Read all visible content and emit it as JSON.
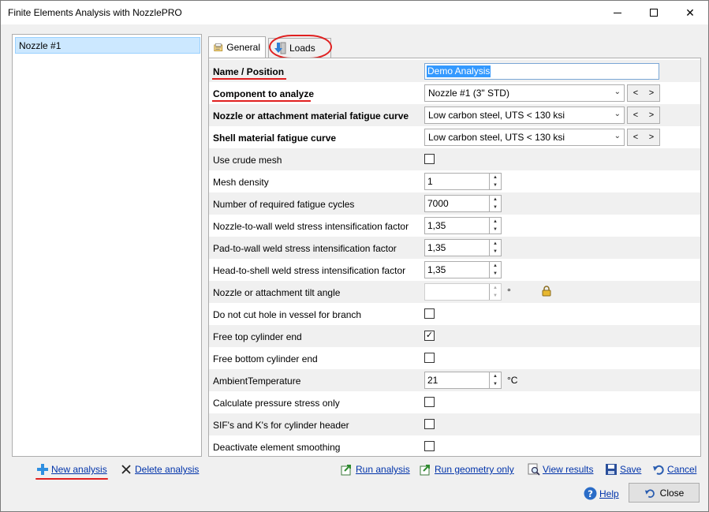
{
  "window": {
    "title": "Finite Elements Analysis with NozzlePRO"
  },
  "analyses": [
    {
      "label": "Nozzle #1"
    }
  ],
  "tabs": {
    "general": "General",
    "loads": "Loads"
  },
  "fields": {
    "name_position": {
      "label": "Name / Position",
      "value": "Demo Analysis"
    },
    "component": {
      "label": "Component to analyze",
      "value": "Nozzle #1 (3\" STD)",
      "prev": "<",
      "next": ">"
    },
    "nozzle_fatigue": {
      "label": "Nozzle or attachment material fatigue curve",
      "value": "Low carbon steel, UTS < 130 ksi",
      "prev": "<",
      "next": ">"
    },
    "shell_fatigue": {
      "label": "Shell material fatigue curve",
      "value": "Low carbon steel, UTS < 130 ksi",
      "prev": "<",
      "next": ">"
    },
    "crude_mesh": {
      "label": "Use crude mesh",
      "checked": false
    },
    "mesh_density": {
      "label": "Mesh density",
      "value": "1"
    },
    "fatigue_cycles": {
      "label": "Number of required fatigue cycles",
      "value": "7000"
    },
    "nozzle_wall_sif": {
      "label": "Nozzle-to-wall weld stress intensification factor",
      "value": "1,35"
    },
    "pad_wall_sif": {
      "label": "Pad-to-wall weld stress intensification factor",
      "value": "1,35"
    },
    "head_shell_sif": {
      "label": "Head-to-shell weld stress intensification factor",
      "value": "1,35"
    },
    "tilt_angle": {
      "label": "Nozzle or attachment tilt angle",
      "value": "",
      "unit": "°"
    },
    "no_cut_hole": {
      "label": "Do not cut hole in vessel for branch",
      "checked": false
    },
    "free_top": {
      "label": "Free top cylinder end",
      "checked": true
    },
    "free_bottom": {
      "label": "Free bottom cylinder end",
      "checked": false
    },
    "ambient_temp": {
      "label": "AmbientTemperature",
      "value": "21",
      "unit": "°C"
    },
    "pressure_only": {
      "label": "Calculate pressure stress only",
      "checked": false
    },
    "sif_k_header": {
      "label": "SIF's and K's for cylinder header",
      "checked": false
    },
    "deactivate_smoothing": {
      "label": "Deactivate element smoothing",
      "checked": false
    }
  },
  "footer": {
    "new_analysis": "New analysis",
    "delete_analysis": "Delete analysis",
    "run_analysis": "Run analysis",
    "run_geometry": "Run geometry only",
    "view_results": "View results",
    "save": "Save",
    "cancel": "Cancel",
    "help": "Help",
    "close": "Close"
  },
  "colors": {
    "selection": "#3399ff",
    "annotation": "#e02020",
    "link": "#0033aa"
  }
}
